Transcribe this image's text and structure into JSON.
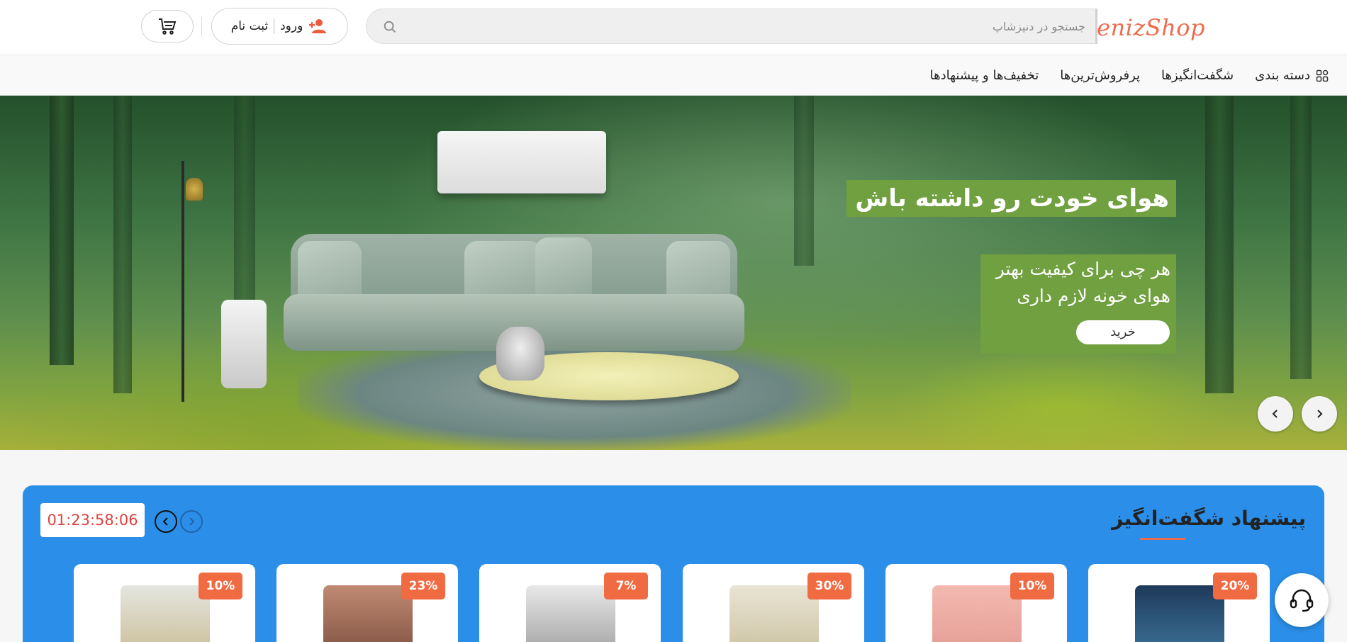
{
  "header": {
    "logo": "DenizShop",
    "search_placeholder": "جستجو در دنیزشاپ",
    "login_label": "ورود",
    "register_label": "ثبت نام"
  },
  "nav": {
    "items": [
      {
        "label": "دسته بندی",
        "icon": "grid-icon"
      },
      {
        "label": "شگفت‌انگیزها"
      },
      {
        "label": "پرفروش‌ترین‌ها"
      },
      {
        "label": "تخفیف‌ها و پیشنهادها"
      }
    ]
  },
  "hero": {
    "title": "هوای خودت رو داشته باش",
    "subtitle_line1": "هر چی برای کیفیت بهتر",
    "subtitle_line2": "هوای خونه لازم داری",
    "button_label": "خرید",
    "accent": "#71a040"
  },
  "amazing": {
    "title": "پیشنهاد شگفت‌انگیز",
    "timer": "01:23:58:06",
    "background": "#2b8fe9",
    "products": [
      {
        "discount": "20%",
        "icon": "phone-product"
      },
      {
        "discount": "10%",
        "icon": "phone-box-product"
      },
      {
        "discount": "30%",
        "icon": "cream-product"
      },
      {
        "discount": "7%",
        "icon": "dishwasher-product"
      },
      {
        "discount": "23%",
        "icon": "chandelier-product"
      },
      {
        "discount": "10%",
        "icon": "fridge-product"
      }
    ]
  },
  "colors": {
    "brand": "#ee6b4d",
    "badge": "#f06a42",
    "timer_text": "#e0413e"
  }
}
